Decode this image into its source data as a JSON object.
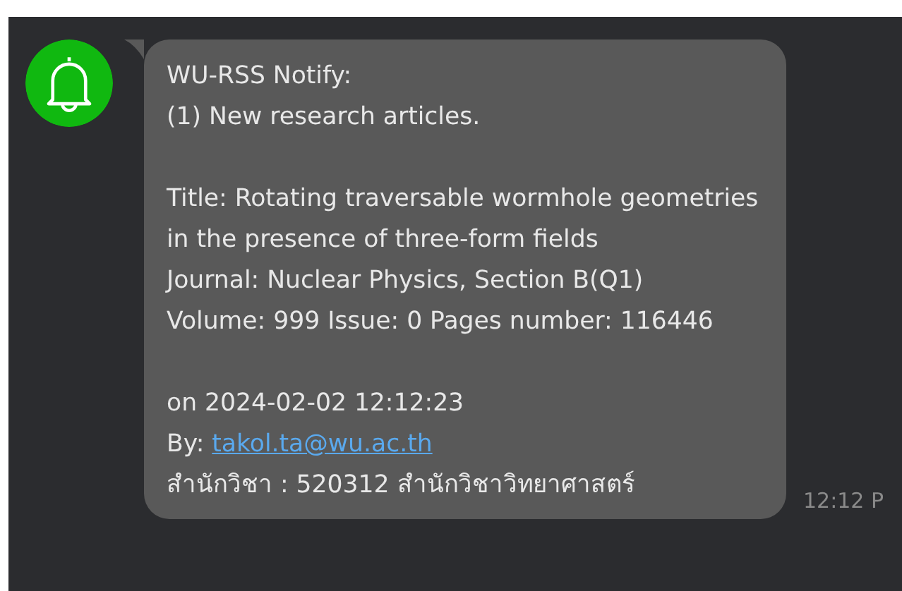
{
  "message": {
    "lines": [
      {
        "kind": "text",
        "text": "WU-RSS Notify:"
      },
      {
        "kind": "text",
        "text": "(1) New research articles."
      },
      {
        "kind": "blank"
      },
      {
        "kind": "text",
        "text": "Title: Rotating traversable wormhole geometries in the presence of three-form fields"
      },
      {
        "kind": "text",
        "text": "Journal: Nuclear Physics, Section B(Q1)"
      },
      {
        "kind": "text",
        "text": "Volume: 999 Issue: 0 Pages number: 116446"
      },
      {
        "kind": "blank"
      },
      {
        "kind": "text",
        "text": "on 2024-02-02 12:12:23"
      },
      {
        "kind": "link",
        "label": "By:",
        "link": "takol.ta@wu.ac.th"
      },
      {
        "kind": "text",
        "text": "สำนักวิชา : 520312 สำนักวิชาวิทยาศาสตร์"
      }
    ],
    "time": "12:12 P"
  }
}
